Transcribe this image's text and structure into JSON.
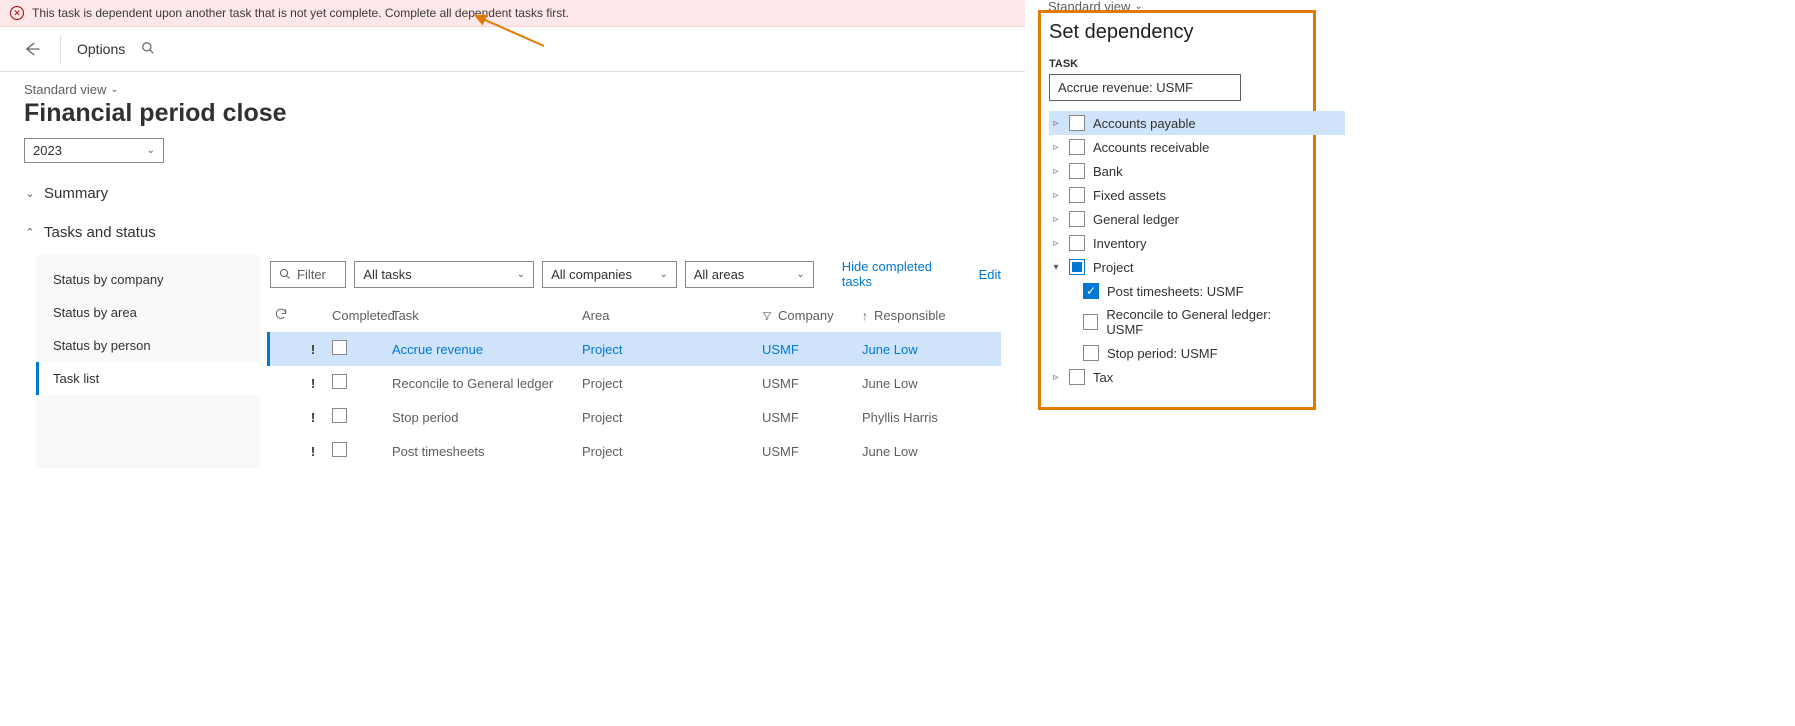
{
  "banner": {
    "message": "This task is dependent upon another task that is not yet complete. Complete all dependent tasks first."
  },
  "toolbar": {
    "options": "Options"
  },
  "header": {
    "standard_view": "Standard view",
    "title": "Financial period close",
    "year": "2023"
  },
  "sections": {
    "summary": "Summary",
    "tasks": "Tasks and status"
  },
  "sideTabs": [
    {
      "label": "Status by company"
    },
    {
      "label": "Status by area"
    },
    {
      "label": "Status by person"
    },
    {
      "label": "Task list"
    }
  ],
  "filters": {
    "filter_placeholder": "Filter",
    "all_tasks": "All tasks",
    "all_companies": "All companies",
    "all_areas": "All areas",
    "hide_completed": "Hide completed tasks",
    "edit": "Edit"
  },
  "columns": {
    "completed": "Completed",
    "task": "Task",
    "area": "Area",
    "company": "Company",
    "responsible": "Responsible"
  },
  "rows": [
    {
      "task": "Accrue revenue",
      "area": "Project",
      "company": "USMF",
      "responsible": "June Low",
      "selected": true
    },
    {
      "task": "Reconcile to General ledger",
      "area": "Project",
      "company": "USMF",
      "responsible": "June Low",
      "selected": false
    },
    {
      "task": "Stop period",
      "area": "Project",
      "company": "USMF",
      "responsible": "Phyllis Harris",
      "selected": false
    },
    {
      "task": "Post timesheets",
      "area": "Project",
      "company": "USMF",
      "responsible": "June Low",
      "selected": false
    }
  ],
  "dep": {
    "view": "Standard view",
    "title": "Set dependency",
    "label": "TASK",
    "input": "Accrue revenue: USMF",
    "tree": [
      {
        "label": "Accounts payable",
        "expanded": false,
        "state": "unchecked",
        "hl": true
      },
      {
        "label": "Accounts receivable",
        "expanded": false,
        "state": "unchecked"
      },
      {
        "label": "Bank",
        "expanded": false,
        "state": "unchecked"
      },
      {
        "label": "Fixed assets",
        "expanded": false,
        "state": "unchecked"
      },
      {
        "label": "General ledger",
        "expanded": false,
        "state": "unchecked"
      },
      {
        "label": "Inventory",
        "expanded": false,
        "state": "unchecked"
      },
      {
        "label": "Project",
        "expanded": true,
        "state": "partial",
        "children": [
          {
            "label": "Post timesheets: USMF",
            "state": "checked"
          },
          {
            "label": "Reconcile to General ledger: USMF",
            "state": "unchecked"
          },
          {
            "label": "Stop period: USMF",
            "state": "unchecked"
          }
        ]
      },
      {
        "label": "Tax",
        "expanded": false,
        "state": "unchecked"
      }
    ]
  }
}
